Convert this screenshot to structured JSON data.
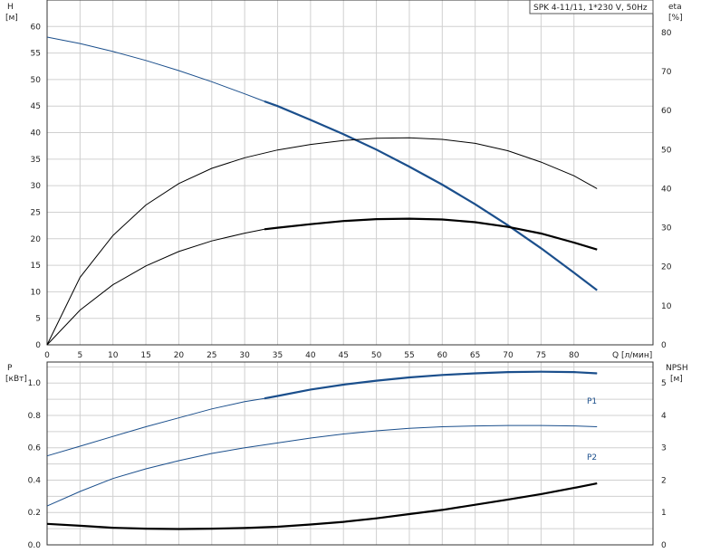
{
  "title": "SPK 4-11/11, 1*230 V, 50Hz",
  "colors": {
    "blue": "#1b4f8c",
    "black": "#000000",
    "grid": "#d0d0d0"
  },
  "chart_data": [
    {
      "type": "line",
      "id": "top",
      "xlabel": "Q [л/мин]",
      "ylabel_left": "H",
      "ylabel_left_unit": "[м]",
      "ylabel_right": "eta",
      "ylabel_right_unit": "[%]",
      "xlim": [
        0,
        92
      ],
      "ylim_left": [
        0,
        65
      ],
      "ylim_right": [
        0,
        88.3
      ],
      "xticks": [
        0,
        5,
        10,
        15,
        20,
        25,
        30,
        35,
        40,
        45,
        50,
        55,
        60,
        65,
        70,
        75,
        80
      ],
      "yticks_left": [
        0,
        5,
        10,
        15,
        20,
        25,
        30,
        35,
        40,
        45,
        50,
        55,
        60
      ],
      "yticks_right": [
        0,
        10,
        20,
        30,
        40,
        50,
        60,
        70,
        80
      ],
      "grid": true,
      "series": [
        {
          "key": "H",
          "axis": "left",
          "color": "#1b4f8c",
          "x": [
            0,
            5,
            10,
            15,
            20,
            25,
            30,
            33,
            35,
            40,
            45,
            50,
            55,
            60,
            65,
            70,
            75,
            80,
            83.5
          ],
          "y": [
            58,
            56.8,
            55.3,
            53.6,
            51.7,
            49.6,
            47.3,
            45.9,
            45.0,
            42.4,
            39.7,
            36.8,
            33.6,
            30.2,
            26.5,
            22.5,
            18.2,
            13.6,
            10.3
          ],
          "emphasis_from": 33
        },
        {
          "key": "eta_total",
          "axis": "right",
          "color": "#000000",
          "x": [
            0,
            5,
            10,
            15,
            20,
            25,
            30,
            35,
            40,
            45,
            50,
            55,
            60,
            65,
            70,
            75,
            80,
            83.5
          ],
          "y": [
            0,
            17.3,
            28.0,
            35.8,
            41.3,
            45.2,
            47.9,
            49.9,
            51.3,
            52.3,
            52.9,
            53.0,
            52.6,
            51.6,
            49.7,
            46.8,
            43.3,
            40.0
          ]
        },
        {
          "key": "eta_pump",
          "axis": "right",
          "color": "#000000",
          "x": [
            0,
            5,
            10,
            15,
            20,
            25,
            30,
            33,
            35,
            40,
            45,
            50,
            55,
            60,
            65,
            70,
            75,
            80,
            83.5
          ],
          "y": [
            0,
            8.9,
            15.4,
            20.2,
            23.9,
            26.6,
            28.6,
            29.6,
            30.0,
            30.9,
            31.7,
            32.2,
            32.3,
            32.1,
            31.4,
            30.2,
            28.5,
            26.2,
            24.4
          ],
          "emphasis_from": 33
        }
      ]
    },
    {
      "type": "line",
      "id": "bottom",
      "ylabel_left": "P",
      "ylabel_left_unit": "[кВт]",
      "ylabel_right": "NPSH",
      "ylabel_right_unit": "[м]",
      "xlim": [
        0,
        92
      ],
      "ylim_left": [
        0,
        1.13
      ],
      "ylim_right": [
        0,
        5.65
      ],
      "yticks_left_labels": [
        "0.0",
        "0.2",
        "0.4",
        "0.6",
        "0.8",
        "1.0"
      ],
      "yticks_left": [
        0,
        0.2,
        0.4,
        0.6,
        0.8,
        1.0
      ],
      "yticks_right": [
        0,
        1,
        2,
        3,
        4,
        5
      ],
      "grid": true,
      "series": [
        {
          "key": "P1",
          "name": "P1",
          "axis": "left",
          "color": "#1b4f8c",
          "x": [
            0,
            5,
            10,
            15,
            20,
            25,
            30,
            33,
            35,
            40,
            45,
            50,
            55,
            60,
            65,
            70,
            75,
            80,
            83.5
          ],
          "y": [
            0.55,
            0.61,
            0.67,
            0.73,
            0.785,
            0.84,
            0.885,
            0.905,
            0.92,
            0.96,
            0.99,
            1.015,
            1.035,
            1.05,
            1.06,
            1.068,
            1.07,
            1.068,
            1.06
          ],
          "emphasis_from": 33
        },
        {
          "key": "P2",
          "name": "P2",
          "axis": "left",
          "color": "#1b4f8c",
          "x": [
            0,
            5,
            10,
            15,
            20,
            25,
            30,
            35,
            40,
            45,
            50,
            55,
            60,
            65,
            70,
            75,
            80,
            83.5
          ],
          "y": [
            0.24,
            0.33,
            0.41,
            0.47,
            0.52,
            0.565,
            0.6,
            0.63,
            0.66,
            0.685,
            0.705,
            0.72,
            0.73,
            0.735,
            0.738,
            0.738,
            0.735,
            0.73
          ]
        },
        {
          "key": "NPSH",
          "axis": "right",
          "color": "#000000",
          "x": [
            0,
            5,
            10,
            15,
            20,
            25,
            30,
            35,
            40,
            45,
            50,
            55,
            60,
            65,
            70,
            75,
            80,
            83.5
          ],
          "y": [
            0.65,
            0.59,
            0.53,
            0.5,
            0.49,
            0.5,
            0.52,
            0.56,
            0.63,
            0.71,
            0.82,
            0.95,
            1.08,
            1.24,
            1.4,
            1.57,
            1.76,
            1.9
          ],
          "emphasis_from": 0
        }
      ]
    }
  ]
}
